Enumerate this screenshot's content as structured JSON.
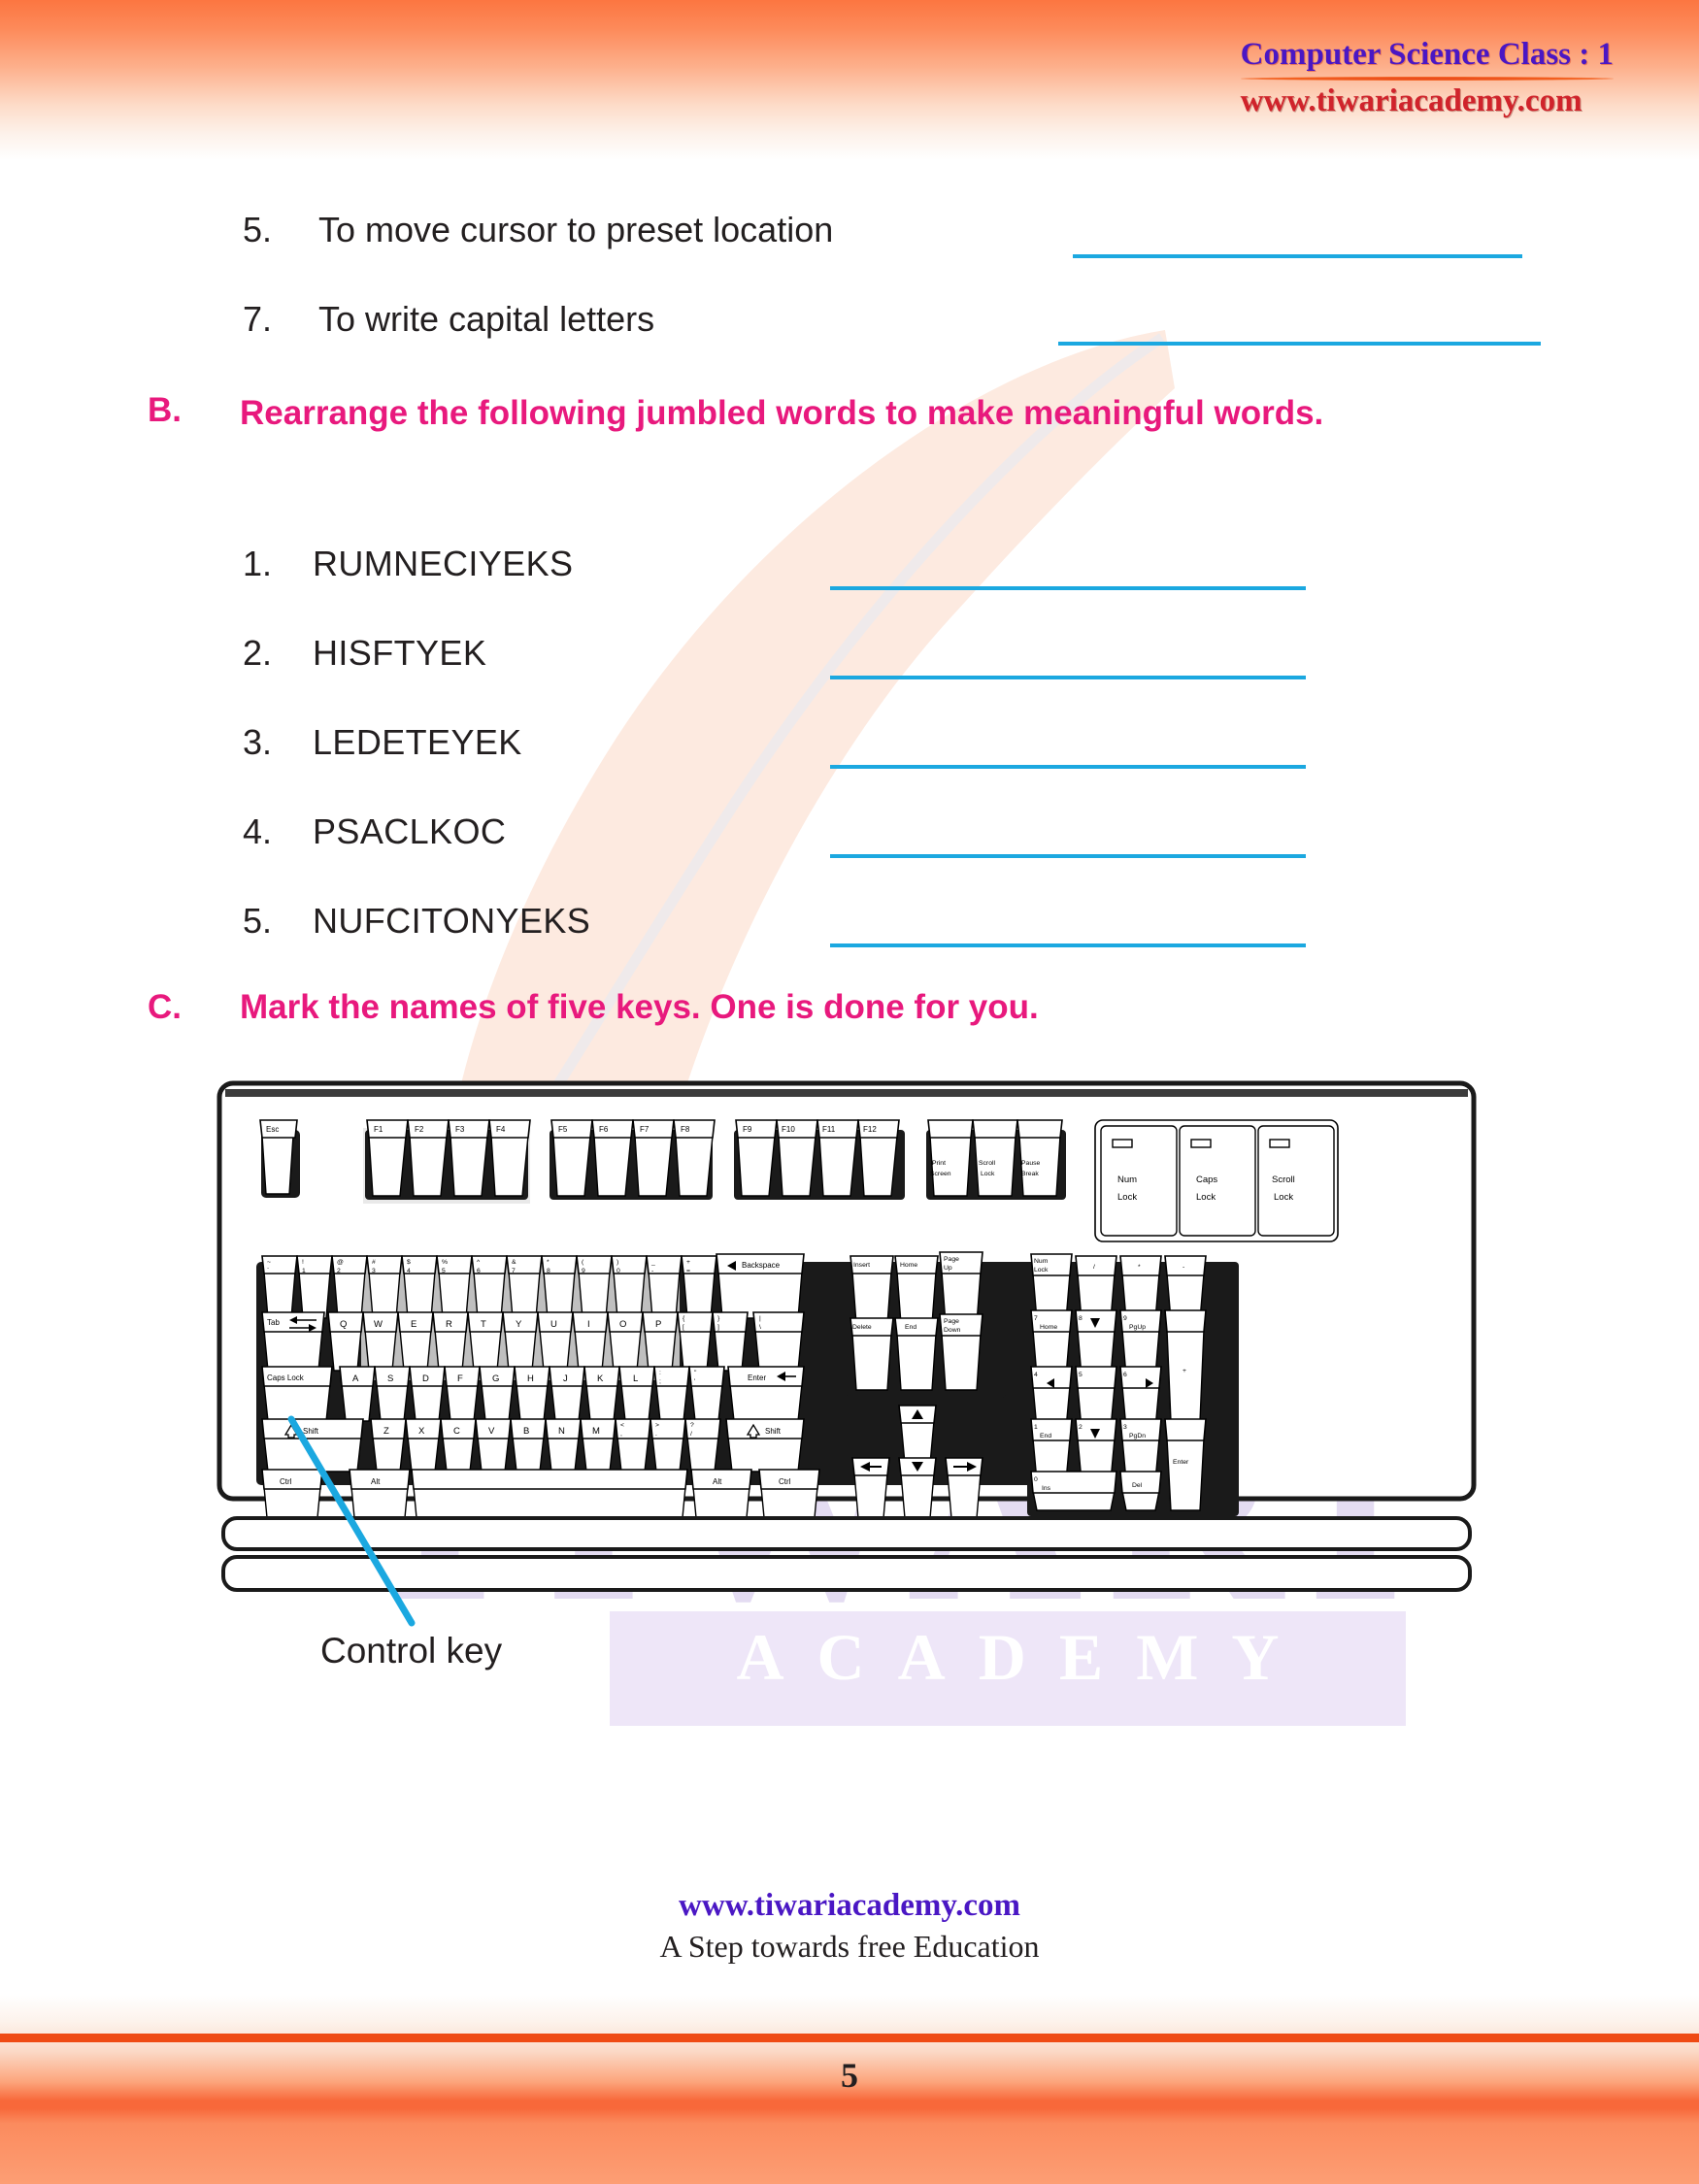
{
  "header": {
    "title": "Computer Science Class : 1",
    "url": "www.tiwariacademy.com"
  },
  "watermark": {
    "brand": "TIWARI",
    "sub": "ACADEMY"
  },
  "colors": {
    "heading_pink": "#e8197d",
    "answer_line_blue": "#1ba8e0",
    "callout_blue": "#1ba8e0",
    "header_orange": "#fc7641",
    "title_purple": "#4a17c4",
    "url_red": "#d0232b",
    "body_black": "#231f20"
  },
  "continued_questions": [
    {
      "num": "5.",
      "text": "To move cursor to preset location"
    },
    {
      "num": "7.",
      "text": "To write capital letters"
    }
  ],
  "section_b": {
    "letter": "B.",
    "title_line1": "Rearrange  the  following  jumbled  words  to  make  meaningful",
    "title_line2": "words.",
    "items": [
      {
        "num": "1.",
        "word": "RUMNECIYEKS"
      },
      {
        "num": "2.",
        "word": "HISFTYEK"
      },
      {
        "num": "3.",
        "word": "LEDETEYEK"
      },
      {
        "num": "4.",
        "word": "PSACLKOC"
      },
      {
        "num": "5.",
        "word": "NUFCITONYEKS"
      }
    ]
  },
  "section_c": {
    "letter": "C.",
    "title": "Mark the names of five keys. One is done for you.",
    "callout_label": "Control key"
  },
  "keyboard": {
    "esc": "Esc",
    "function_group_1": [
      "F1",
      "F2",
      "F3",
      "F4"
    ],
    "function_group_2": [
      "F5",
      "F6",
      "F7",
      "F8"
    ],
    "function_group_3": [
      "F9",
      "F10",
      "F11",
      "F12"
    ],
    "system_keys": [
      {
        "top": "Print",
        "bottom": "Screen"
      },
      {
        "top": "Scroll",
        "bottom": "Lock"
      },
      {
        "top": "Pause",
        "bottom": "Break"
      }
    ],
    "leds": [
      {
        "top": "Num",
        "bottom": "Lock"
      },
      {
        "top": "Caps",
        "bottom": "Lock"
      },
      {
        "top": "Scroll",
        "bottom": "Lock"
      }
    ],
    "number_row": [
      {
        "upper": "~",
        "lower": "`"
      },
      {
        "upper": "!",
        "lower": "1"
      },
      {
        "upper": "@",
        "lower": "2"
      },
      {
        "upper": "#",
        "lower": "3"
      },
      {
        "upper": "$",
        "lower": "4"
      },
      {
        "upper": "%",
        "lower": "5"
      },
      {
        "upper": "^",
        "lower": "6"
      },
      {
        "upper": "&",
        "lower": "7"
      },
      {
        "upper": "*",
        "lower": "8"
      },
      {
        "upper": "(",
        "lower": "9"
      },
      {
        "upper": ")",
        "lower": "0"
      },
      {
        "upper": "_",
        "lower": "-"
      },
      {
        "upper": "+",
        "lower": "="
      }
    ],
    "backspace": "Backspace",
    "tab": "Tab",
    "qwerty_row": [
      "Q",
      "W",
      "E",
      "R",
      "T",
      "Y",
      "U",
      "I",
      "O",
      "P"
    ],
    "qwerty_tail": [
      {
        "upper": "{",
        "lower": "["
      },
      {
        "upper": "}",
        "lower": "]"
      }
    ],
    "caps_lock": "Caps Lock",
    "asdf_row": [
      "A",
      "S",
      "D",
      "F",
      "G",
      "H",
      "J",
      "K",
      "L"
    ],
    "asdf_tail": [
      {
        "upper": ":",
        "lower": ";"
      },
      {
        "upper": "\"",
        "lower": "'"
      },
      {
        "upper": "|",
        "lower": "\\"
      }
    ],
    "enter": "Enter",
    "shift_left": "Shift",
    "shift_right": "Shift",
    "zxcv_row": [
      "Z",
      "X",
      "C",
      "V",
      "B",
      "N",
      "M"
    ],
    "zxcv_tail": [
      {
        "upper": "<",
        "lower": ","
      },
      {
        "upper": ">",
        "lower": "."
      },
      {
        "upper": "?",
        "lower": "/"
      }
    ],
    "ctrl_left": "Ctrl",
    "alt_left": "Alt",
    "alt_right": "Alt",
    "ctrl_right": "Ctrl",
    "nav_cluster": [
      {
        "label": "Insert"
      },
      {
        "label": "Home"
      },
      {
        "top": "Page",
        "bottom": "Up"
      },
      {
        "label": "Delete"
      },
      {
        "label": "End"
      },
      {
        "top": "Page",
        "bottom": "Down"
      }
    ],
    "arrows": [
      "↑",
      "←",
      "↓",
      "→"
    ],
    "numpad": {
      "row0": [
        {
          "top": "Num",
          "bottom": "Lock"
        },
        {
          "label": "/"
        },
        {
          "label": "*"
        },
        {
          "label": "-"
        }
      ],
      "row1": [
        {
          "num": "7",
          "fn": "Home"
        },
        {
          "num": "8",
          "fn": "↑"
        },
        {
          "num": "9",
          "fn": "PgUp"
        }
      ],
      "row2": [
        {
          "num": "4",
          "fn": "←"
        },
        {
          "num": "5",
          "fn": ""
        },
        {
          "num": "6",
          "fn": "→"
        }
      ],
      "row3": [
        {
          "num": "1",
          "fn": "End"
        },
        {
          "num": "2",
          "fn": "↓"
        },
        {
          "num": "3",
          "fn": "PgDn"
        }
      ],
      "row4": [
        {
          "num": "0",
          "fn": "Ins"
        },
        {
          "fn": "Del"
        }
      ],
      "plus": "+",
      "enter": "Enter"
    }
  },
  "footer": {
    "url": "www.tiwariacademy.com",
    "tagline": "A Step towards free Education",
    "page": "5"
  }
}
